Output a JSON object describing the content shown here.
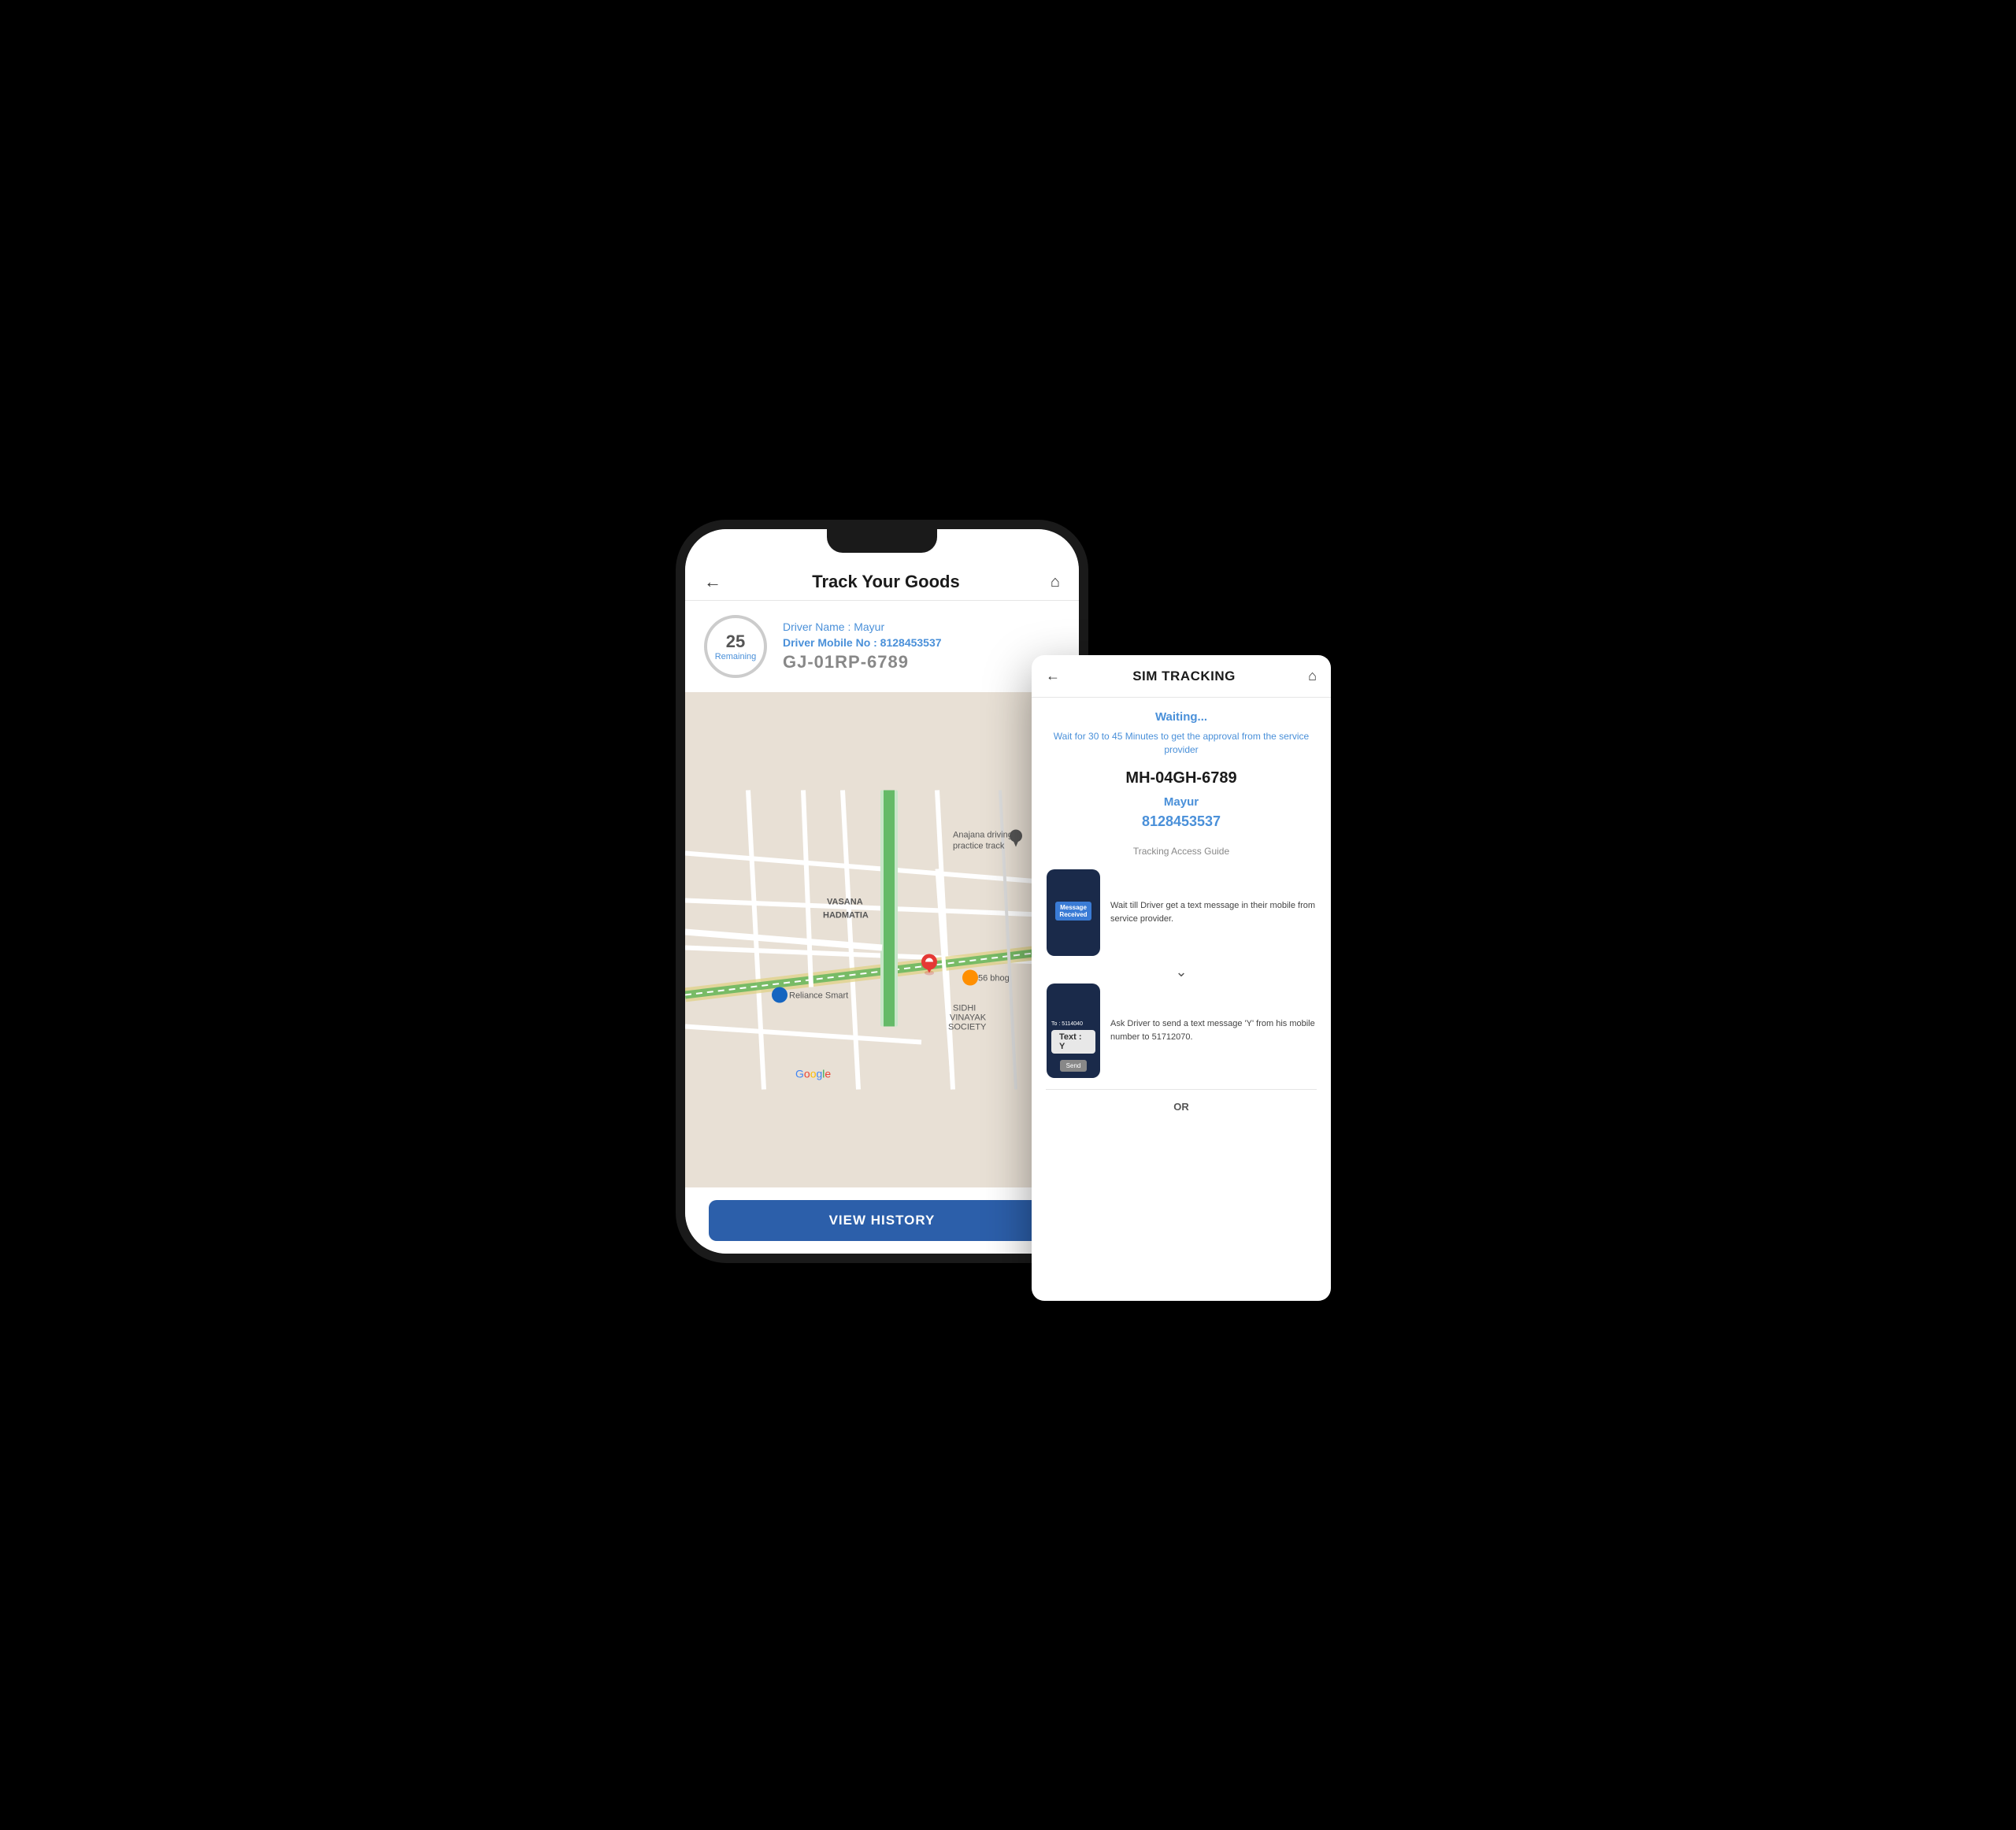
{
  "mainPhone": {
    "header": {
      "title": "Track Your Goods",
      "back_icon": "←",
      "home_icon": "⌂"
    },
    "driver": {
      "remaining_number": "25",
      "remaining_label": "Remaining",
      "name_label": "Driver Name : Mayur",
      "mobile_label": "Driver Mobile No : 8128453537",
      "vehicle_number": "GJ-01RP-6789"
    },
    "view_history_button": "VIEW HISTORY"
  },
  "simCard": {
    "header": {
      "title": "SIM TRACKING",
      "back_icon": "←",
      "home_icon": "⌂"
    },
    "waiting_text": "Waiting...",
    "wait_description": "Wait for 30 to 45 Minutes to get the approval from the service provider",
    "vehicle_number": "MH-04GH-6789",
    "driver_name": "Mayur",
    "driver_phone": "8128453537",
    "tracking_guide_label": "Tracking Access Guide",
    "guide_step1": {
      "phone_line1": "Message",
      "phone_line2": "Received",
      "description": "Wait till Driver get a text message in their mobile from service provider."
    },
    "guide_step2": {
      "to_label": "To : 5114040",
      "text_label": "Text : Y",
      "send_label": "Send",
      "description": "Ask Driver to send a text message 'Y' from his mobile number to 51712070."
    },
    "or_text": "OR"
  },
  "map": {
    "labels": [
      "VASANA HADMATIA",
      "Anajana driving practice track",
      "Reliance Smart",
      "SIDHI VINAYAK SOCIETY",
      "56 bhog",
      "Google"
    ]
  }
}
